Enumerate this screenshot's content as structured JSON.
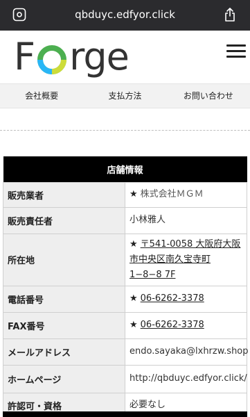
{
  "browser": {
    "url": "qbduyc.edfyor.click"
  },
  "header": {
    "logo_prefix": "F",
    "logo_suffix": "rge"
  },
  "nav": {
    "items": [
      "会社概要",
      "支払方法",
      "お問い合わせ"
    ]
  },
  "store_info": {
    "title": "店舗情報",
    "rows": [
      {
        "label": "販売業者",
        "value": "株式会社ＭＧＭ"
      },
      {
        "label": "販売責任者",
        "value": "小林雅人"
      },
      {
        "label": "所在地",
        "value": "〒541-0058 大阪府大阪市中央区南久宝寺町1−8−8 7F"
      },
      {
        "label": "電話番号",
        "value": "06-6262-3378"
      },
      {
        "label": "FAX番号",
        "value": "06-6262-3378"
      },
      {
        "label": "メールアドレス",
        "value": "endo.sayaka@lxhrzw.shop"
      },
      {
        "label": "ホームページ",
        "value": "http://qbduyc.edfyor.click/"
      },
      {
        "label": "許認可・資格",
        "value": "必要なし"
      }
    ]
  },
  "colors": {
    "urlbar_bg": "#2b2b2e",
    "table_header_bg": "#000000",
    "label_bg": "#eeeeee",
    "link_red": "#c8443a",
    "logo_green": "#4caf50",
    "logo_cyan": "#29b6f6",
    "logo_yellow": "#cddc39"
  },
  "icons": {
    "url_left": "page-settings-icon",
    "share": "share-icon",
    "menu": "hamburger-menu-icon",
    "star": "star-icon"
  }
}
